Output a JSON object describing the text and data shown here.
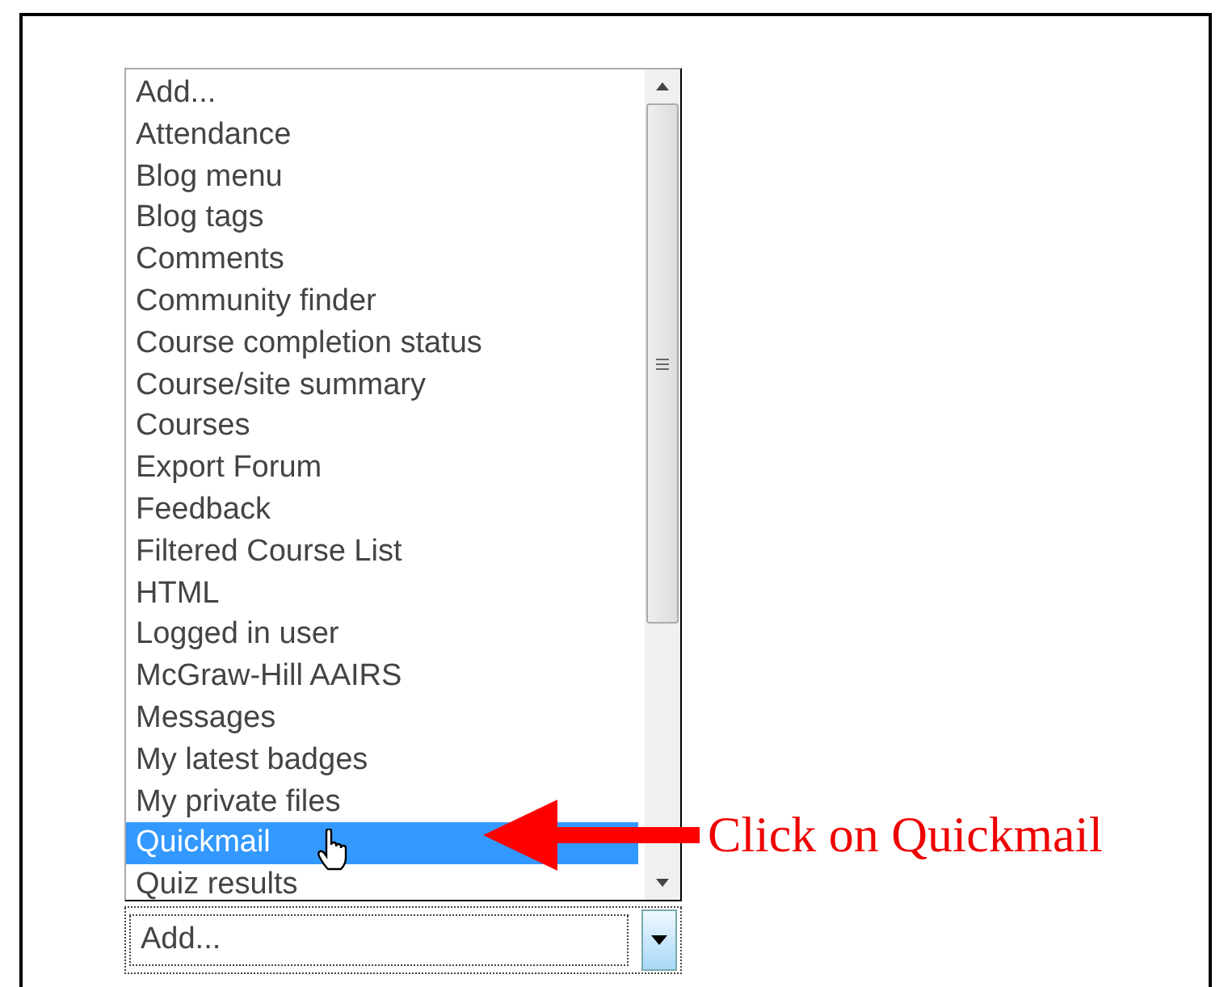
{
  "listbox": {
    "items": [
      {
        "label": "Add...",
        "selected": false
      },
      {
        "label": "Attendance",
        "selected": false
      },
      {
        "label": "Blog menu",
        "selected": false
      },
      {
        "label": "Blog tags",
        "selected": false
      },
      {
        "label": "Comments",
        "selected": false
      },
      {
        "label": "Community finder",
        "selected": false
      },
      {
        "label": "Course completion status",
        "selected": false
      },
      {
        "label": "Course/site summary",
        "selected": false
      },
      {
        "label": "Courses",
        "selected": false
      },
      {
        "label": "Export Forum",
        "selected": false
      },
      {
        "label": "Feedback",
        "selected": false
      },
      {
        "label": "Filtered Course List",
        "selected": false
      },
      {
        "label": "HTML",
        "selected": false
      },
      {
        "label": "Logged in user",
        "selected": false
      },
      {
        "label": "McGraw-Hill AAIRS",
        "selected": false
      },
      {
        "label": "Messages",
        "selected": false
      },
      {
        "label": "My latest badges",
        "selected": false
      },
      {
        "label": "My private files",
        "selected": false
      },
      {
        "label": "Quickmail",
        "selected": true
      },
      {
        "label": "Quiz results",
        "selected": false
      }
    ]
  },
  "dropdown": {
    "value": "Add..."
  },
  "annotation": {
    "text": "Click on Quickmail"
  }
}
